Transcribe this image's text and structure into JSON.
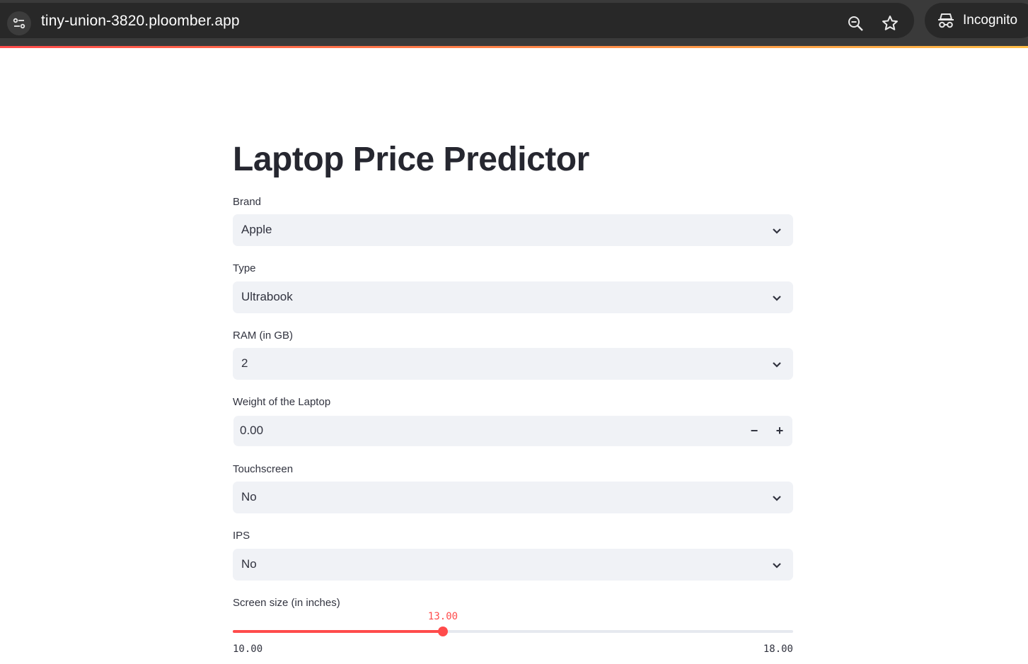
{
  "browser": {
    "url": "tiny-union-3820.ploomber.app",
    "profile_label": "Incognito",
    "icons": [
      "site-info-icon",
      "zoom-icon",
      "bookmark-star-icon",
      "incognito-icon"
    ]
  },
  "page": {
    "title": "Laptop Price Predictor"
  },
  "form": {
    "brand": {
      "label": "Brand",
      "value": "Apple"
    },
    "type": {
      "label": "Type",
      "value": "Ultrabook"
    },
    "ram": {
      "label": "RAM (in GB)",
      "value": "2"
    },
    "weight": {
      "label": "Weight of the Laptop",
      "value": "0.00",
      "decrement": "−",
      "increment": "+"
    },
    "touchscreen": {
      "label": "Touchscreen",
      "value": "No"
    },
    "ips": {
      "label": "IPS",
      "value": "No"
    },
    "screen_size": {
      "label": "Screen size (in inches)",
      "value": 13.0,
      "value_label": "13.00",
      "min": 10.0,
      "max": 18.0,
      "min_label": "10.00",
      "max_label": "18.00"
    }
  },
  "colors": {
    "accent": "#ff4b4b",
    "input_bg": "#f0f2f6",
    "text": "#31333f",
    "title": "#262730"
  }
}
